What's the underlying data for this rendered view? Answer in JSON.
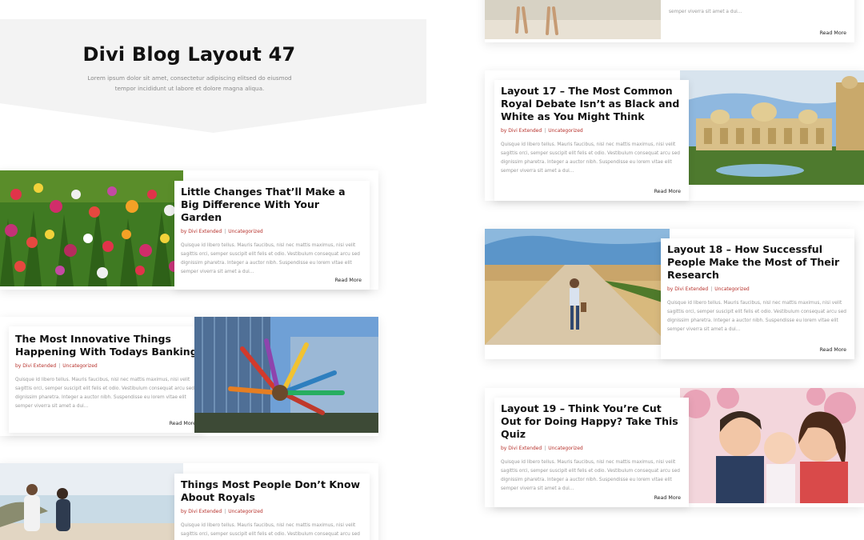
{
  "header": {
    "title": "Divi Blog Layout 47",
    "subtitle": "Lorem ipsum dolor sit amet, consectetur adipiscing elitsed do eiusmod tempor incididunt ut labore et dolore magna aliqua."
  },
  "left_posts": [
    {
      "title": "Little Changes That’ll Make a Big Difference With Your Garden",
      "author": "by Divi Extended",
      "category": "Uncategorized",
      "excerpt": "Quisque id libero tellus. Mauris faucibus, nisl nec mattis maximus, nisi velit sagittis orci, semper suscipit elit felis et odio. Vestibulum consequat arcu sed dignissim pharetra. Integer a auctor nibh. Suspendisse eu lorem vitae elit semper viverra sit amet a dui...",
      "read_more": "Read More",
      "image_icon": "flowers-image"
    },
    {
      "title": "The Most Innovative Things Happening With Todays Banking",
      "author": "by Divi Extended",
      "category": "Uncategorized",
      "excerpt": "Quisque id libero tellus. Mauris faucibus, nisl nec mattis maximus, nisi velit sagittis orci, semper suscipit elit felis et odio. Vestibulum consequat arcu sed dignissim pharetra. Integer a auctor nibh. Suspendisse eu lorem vitae elit semper viverra sit amet a dui...",
      "read_more": "Read More",
      "image_icon": "glass-building-sculpture-image"
    },
    {
      "title": "Things Most People Don’t Know About Royals",
      "author": "by Divi Extended",
      "category": "Uncategorized",
      "excerpt": "Quisque id libero tellus. Mauris faucibus, nisl nec mattis maximus, nisi velit sagittis orci, semper suscipit elit felis et odio. Vestibulum consequat arcu sed",
      "read_more": "",
      "image_icon": "beach-couple-image"
    }
  ],
  "right_top": {
    "excerpt": "semper viverra sit amet a dui...",
    "read_more": "Read More",
    "image_icon": "beach-walk-image"
  },
  "right_posts": [
    {
      "title": "Layout 17 – The Most Common Royal Debate Isn’t as Black and White as You Might Think",
      "author": "by Divi Extended",
      "category": "Uncategorized",
      "excerpt": "Quisque id libero tellus. Mauris faucibus, nisl nec mattis maximus, nisi velit sagittis orci, semper suscipit elit felis et odio. Vestibulum consequat arcu sed dignissim pharetra. Integer a auctor nibh. Suspendisse eu lorem vitae elit semper viverra sit amet a dui...",
      "read_more": "Read More",
      "image_icon": "palace-image"
    },
    {
      "title": "Layout 18 – How Successful People Make the Most of Their Research",
      "author": "by Divi Extended",
      "category": "Uncategorized",
      "excerpt": "Quisque id libero tellus. Mauris faucibus, nisl nec mattis maximus, nisi velit sagittis orci, semper suscipit elit felis et odio. Vestibulum consequat arcu sed dignissim pharetra. Integer a auctor nibh. Suspendisse eu lorem vitae elit semper viverra sit amet a dui...",
      "read_more": "Read More",
      "image_icon": "road-walker-image"
    },
    {
      "title": "Layout 19 – Think You’re Cut Out for Doing Happy? Take This Quiz",
      "author": "by Divi Extended",
      "category": "Uncategorized",
      "excerpt": "Quisque id libero tellus. Mauris faucibus, nisl nec mattis maximus, nisi velit sagittis orci, semper suscipit elit felis et odio. Vestibulum consequat arcu sed dignissim pharetra. Integer a auctor nibh. Suspendisse eu lorem vitae elit semper viverra sit amet a dui...",
      "read_more": "Read More",
      "image_icon": "family-image"
    }
  ],
  "colors": {
    "accent": "#b7322c",
    "header_bg": "#f3f3f3"
  }
}
